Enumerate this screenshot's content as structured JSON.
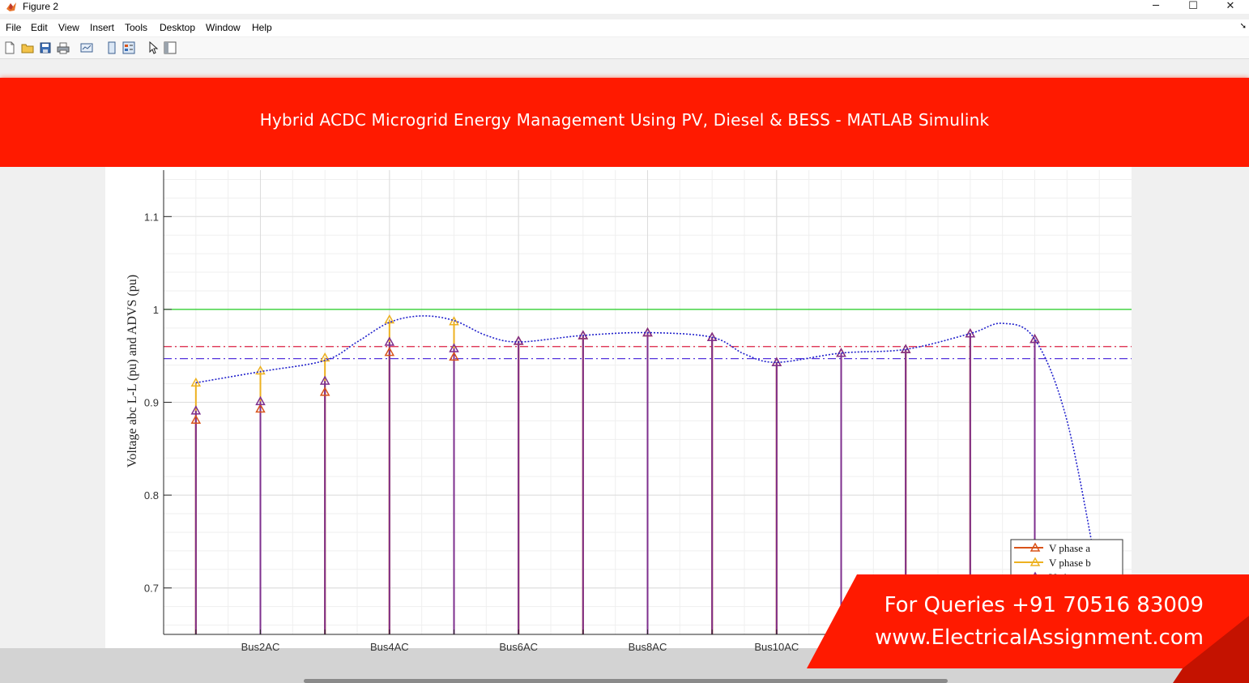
{
  "window": {
    "title": "Figure 2",
    "minimize": "─",
    "maximize": "☐",
    "close": "✕"
  },
  "menu": [
    "File",
    "Edit",
    "View",
    "Insert",
    "Tools",
    "Desktop",
    "Window",
    "Help"
  ],
  "toolbar_icons": [
    "new-figure-icon",
    "open-file-icon",
    "save-icon",
    "print-icon",
    "link-plot-icon",
    "hide-plot-tools-icon",
    "show-plot-tools-icon",
    "edit-plot-icon",
    "property-inspector-icon"
  ],
  "banner": {
    "text": "Hybrid ACDC Microgrid Energy Management Using PV, Diesel & BESS - MATLAB Simulink"
  },
  "promo": {
    "line1": "For Queries +91 70516 83009",
    "line2": "www.ElectricalAssignment.com"
  },
  "colors": {
    "banner": "#ff1a00",
    "phase_a": "#d95319",
    "phase_b": "#edb120",
    "phase_c": "#7e2f8e",
    "ref_line": "#22cc22",
    "upper_limit": "#dd2244",
    "lower_limit": "#5533dd",
    "fit_curve": "#2222cc"
  },
  "chart_data": {
    "type": "line",
    "ylabel": "Voltage abc L-L (pu) and ADVS (pu)",
    "xlabel": "",
    "ylim": [
      0.65,
      1.15
    ],
    "yticks": [
      0.7,
      0.8,
      0.9,
      1.0,
      1.1
    ],
    "ytick_labels": [
      "0.7",
      "0.8",
      "0.9",
      "1",
      "1.1"
    ],
    "xlim": [
      0.5,
      15.5
    ],
    "xticks": [
      2,
      4,
      6,
      8,
      10
    ],
    "xtick_labels": [
      "Bus2AC",
      "Bus4AC",
      "Bus6AC",
      "Bus8AC",
      "Bus10AC"
    ],
    "grid": true,
    "x": [
      1,
      2,
      3,
      4,
      5,
      6,
      7,
      8,
      9,
      10,
      11,
      12,
      13,
      14
    ],
    "series": [
      {
        "name": "V phase a",
        "kind": "stem",
        "values": [
          0.881,
          0.893,
          0.911,
          0.954,
          0.949,
          0.966,
          0.972,
          0.975,
          0.97,
          0.943,
          0.953,
          0.957,
          0.974,
          0.968
        ]
      },
      {
        "name": "V phase b",
        "kind": "stem",
        "values": [
          0.921,
          0.934,
          0.948,
          0.989,
          0.987,
          0.966,
          0.972,
          0.975,
          0.97,
          0.943,
          0.953,
          0.957,
          0.974,
          0.968
        ]
      },
      {
        "name": "V phase c",
        "kind": "stem",
        "values": [
          0.891,
          0.901,
          0.923,
          0.965,
          0.958,
          0.966,
          0.972,
          0.975,
          0.97,
          0.943,
          0.953,
          0.957,
          0.974,
          0.968
        ]
      }
    ],
    "fit_curve": {
      "x": [
        1,
        2,
        3,
        3.5,
        4,
        4.5,
        5,
        5.5,
        6,
        7,
        8,
        9,
        9.5,
        10,
        11,
        12,
        13,
        13.5,
        14,
        14.5,
        15
      ],
      "values": [
        0.921,
        0.933,
        0.945,
        0.965,
        0.986,
        0.993,
        0.988,
        0.972,
        0.965,
        0.972,
        0.975,
        0.97,
        0.952,
        0.943,
        0.953,
        0.957,
        0.974,
        0.985,
        0.968,
        0.88,
        0.705
      ]
    },
    "reference_lines": [
      {
        "value": 1.0,
        "style": "solid",
        "color": "#22cc22"
      },
      {
        "value": 0.96,
        "style": "dashdot",
        "color": "#dd2244"
      },
      {
        "value": 0.947,
        "style": "dashdot",
        "color": "#5533dd"
      }
    ],
    "legend": {
      "location": "bottom-right",
      "entries": [
        "V phase a",
        "V phase b",
        "V phase c"
      ]
    }
  }
}
